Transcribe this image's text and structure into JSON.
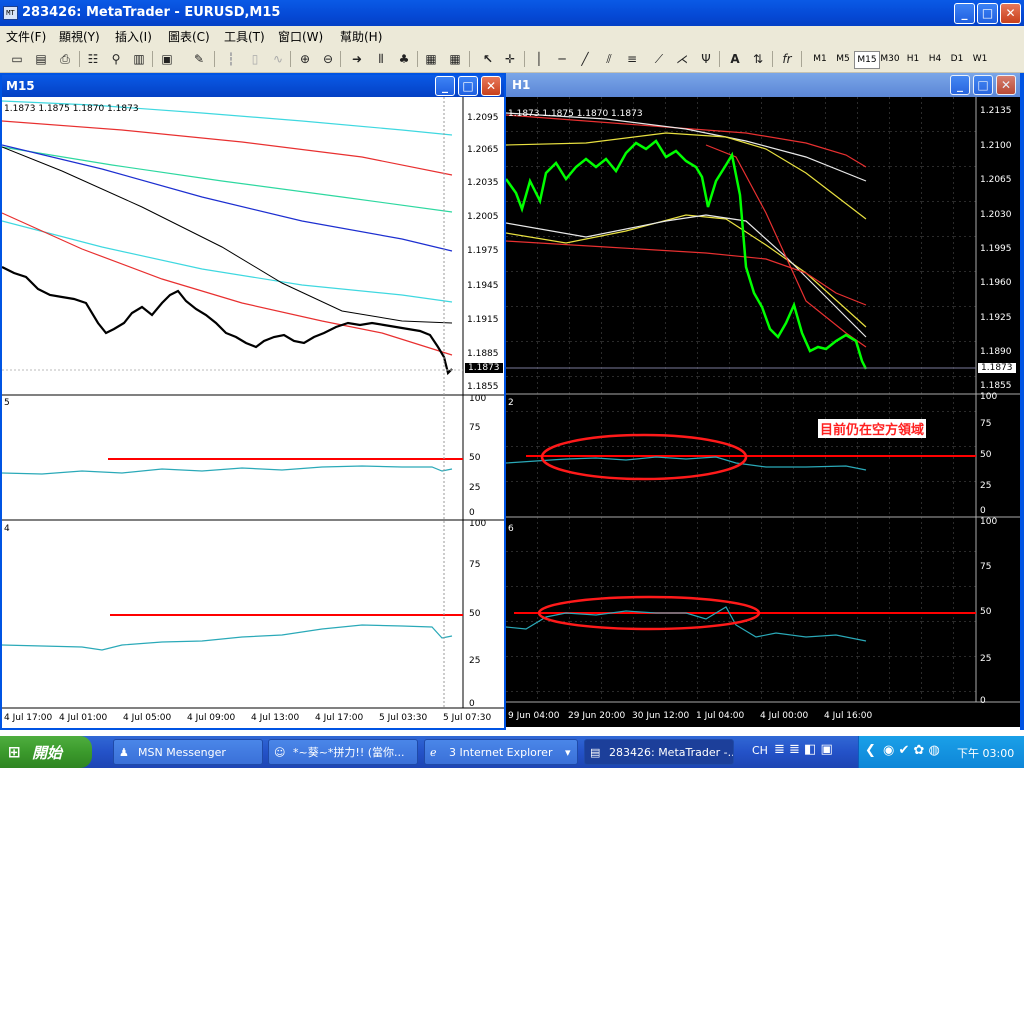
{
  "app": {
    "title": "283426: MetaTrader - EURUSD,M15",
    "icon_text": "MT"
  },
  "window_buttons": {
    "minimize": "_",
    "maximize": "□",
    "close": "✕"
  },
  "menu": [
    "文件(F)",
    "顯視(Y)",
    "插入(I)",
    "圖表(C)",
    "工具(T)",
    "窗口(W)",
    "幫助(H)"
  ],
  "toolbar": {
    "timeframes": [
      "M1",
      "M5",
      "M15",
      "M30",
      "H1",
      "H4",
      "D1",
      "W1"
    ],
    "selected_timeframe": "M15"
  },
  "left_chart": {
    "title": "M15",
    "ohlc": "1.1873 1.1875 1.1870 1.1873",
    "price_ticks": [
      "1.2095",
      "1.2065",
      "1.2035",
      "1.2005",
      "1.1975",
      "1.1945",
      "1.1915",
      "1.1885",
      "1.1855"
    ],
    "current_price": "1.1873",
    "ind1_label": "5",
    "ind1_ticks": [
      "100",
      "75",
      "50",
      "25",
      "0"
    ],
    "ind2_label": "4",
    "ind2_ticks": [
      "100",
      "75",
      "50",
      "25",
      "0"
    ],
    "time_ticks": [
      "4 Jul 17:00",
      "4 Jul 01:00",
      "4 Jul 05:00",
      "4 Jul 09:00",
      "4 Jul 13:00",
      "4 Jul 17:00",
      "5 Jul 03:30",
      "5 Jul 07:30"
    ]
  },
  "right_chart": {
    "title": "H1",
    "ohlc": "1.1873 1.1875 1.1870 1.1873",
    "price_ticks": [
      "1.2135",
      "1.2100",
      "1.2065",
      "1.2030",
      "1.1995",
      "1.1960",
      "1.1925",
      "1.1890",
      "1.1855"
    ],
    "current_price": "1.1873",
    "ind1_label": "2",
    "ind1_ticks": [
      "100",
      "75",
      "50",
      "25",
      "0"
    ],
    "ind2_label": "6",
    "ind2_ticks": [
      "100",
      "75",
      "50",
      "25",
      "0"
    ],
    "annotation": "目前仍在空方領域",
    "time_ticks": [
      "9 Jun 04:00",
      "29 Jun 20:00",
      "30 Jun 12:00",
      "1 Jul 04:00",
      "4 Jul 00:00",
      "4 Jul 16:00"
    ]
  },
  "taskbar": {
    "start": "開始",
    "tasks": [
      {
        "label": "MSN Messenger"
      },
      {
        "label": "*~葵~*拼力!! (當你..."
      },
      {
        "label": "3 Internet Explorer"
      },
      {
        "label": "283426: MetaTrader -..."
      }
    ],
    "lang": "CH",
    "clock": "下午 03:00"
  },
  "colors": {
    "title_bar": "#0a5ae6",
    "taskbar": "#2452c8",
    "start_button": "#3b9a2c",
    "level_line": "#ff0000",
    "indicator": "#2aa9b8",
    "candle_up": "#00ff00",
    "annotation": "#ff0000"
  }
}
